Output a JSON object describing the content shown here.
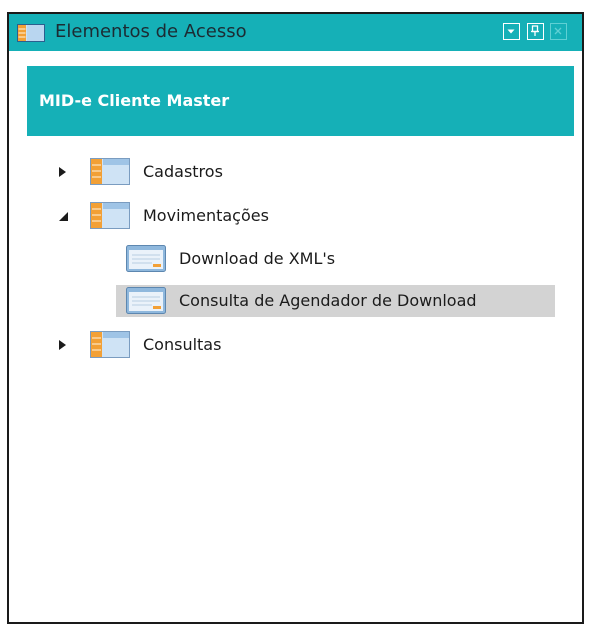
{
  "window": {
    "title": "Elementos de Acesso",
    "buttons": [
      "dropdown-icon",
      "pin-icon",
      "close-icon"
    ]
  },
  "header": {
    "label": "MID-e Cliente Master"
  },
  "tree": {
    "nodes": [
      {
        "label": "Cadastros",
        "state": "collapsed"
      },
      {
        "label": "Movimentações",
        "state": "expanded",
        "children": [
          {
            "label": "Download de XML's"
          },
          {
            "label": "Consulta de Agendador de Download",
            "selected": true
          }
        ]
      },
      {
        "label": "Consultas",
        "state": "collapsed"
      }
    ]
  },
  "colors": {
    "accent": "#15b0b7",
    "selection": "#d3d3d3",
    "folder_orange": "#f2a036",
    "folder_blue": "#6fa8dc"
  }
}
